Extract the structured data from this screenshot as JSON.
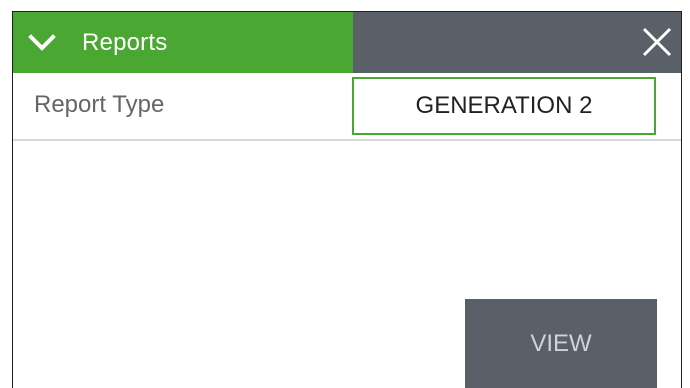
{
  "header": {
    "title": "Reports",
    "chevron_icon": "chevron-down-icon",
    "close_icon": "close-icon"
  },
  "report_type": {
    "label": "Report Type",
    "value": "GENERATION 2"
  },
  "actions": {
    "view_label": "VIEW"
  },
  "colors": {
    "accent_green": "#4aa832",
    "header_dark": "#5a6068",
    "button_gray": "#5a6068"
  }
}
